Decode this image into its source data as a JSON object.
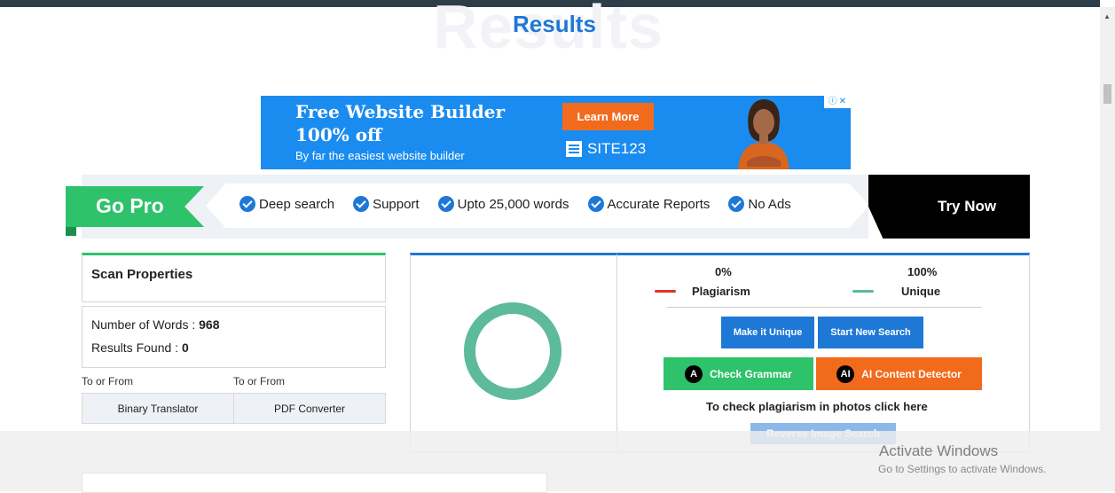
{
  "page": {
    "title": "Results",
    "title_watermark": "Results"
  },
  "ad": {
    "headline_line1": "Free Website Builder",
    "headline_line2": "100% off",
    "subtext": "By far the easiest website builder",
    "cta": "Learn More",
    "brand": "SITE123",
    "adchoices_icon": "adchoices-icon",
    "close_icon": "close-icon"
  },
  "gopro": {
    "badge": "Go Pro",
    "features": [
      "Deep search",
      "Support",
      "Upto 25,000 words",
      "Accurate Reports",
      "No Ads"
    ],
    "cta": "Try Now",
    "check_icon": "check-circle-icon"
  },
  "scan": {
    "heading": "Scan Properties",
    "words_label": "Number of Words : ",
    "words_value": "968",
    "results_label": "Results Found : ",
    "results_value": "0"
  },
  "tools": [
    {
      "caption": "To or From",
      "label": "Binary Translator"
    },
    {
      "caption": "To or From",
      "label": "PDF Converter"
    }
  ],
  "results": {
    "plagiarism_pct": "0%",
    "unique_pct": "100%",
    "plagiarism_label": "Plagiarism",
    "unique_label": "Unique",
    "make_unique": "Make it Unique",
    "new_search": "Start New Search",
    "check_grammar": "Check Grammar",
    "ai_detector": "AI Content Detector",
    "photo_text": "To check plagiarism in photos click here",
    "reverse_image": "Reverse Image Search",
    "colors": {
      "plagiarism": "#e0312e",
      "unique": "#5dbb99",
      "grammar": "#2ec26a",
      "ai": "#f26b1d",
      "accent": "#1e78d6"
    }
  },
  "windows": {
    "line1": "Activate Windows",
    "line2": "Go to Settings to activate Windows."
  }
}
